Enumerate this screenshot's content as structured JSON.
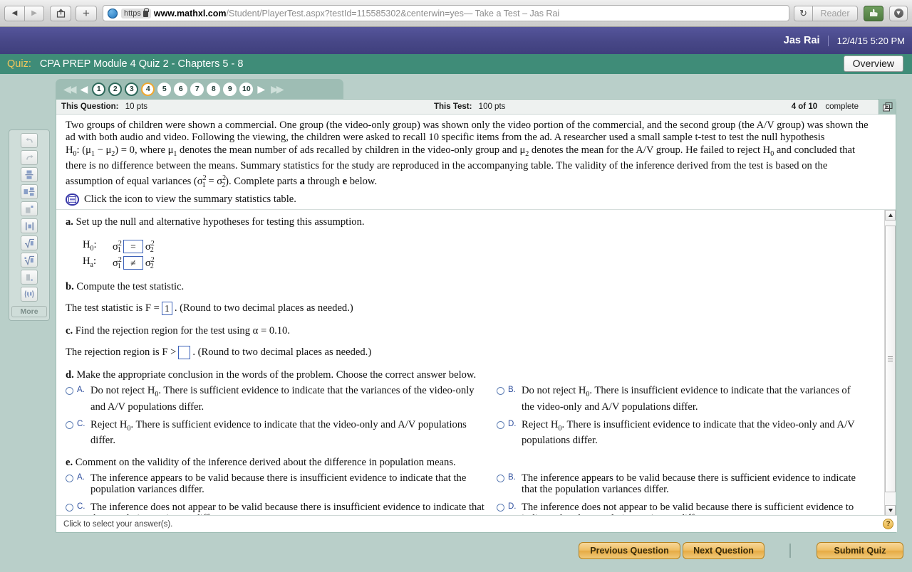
{
  "browser": {
    "back_icon": "back-arrow-icon",
    "forward_icon": "forward-arrow-icon",
    "share_icon": "share-icon",
    "new_tab_label": "+",
    "https_label": "https",
    "url_domain": "www.mathxl.com",
    "url_path": "/Student/PlayerTest.aspx?testId=115585302&centerwin=yes",
    "page_title": " — Take a Test – Jas Rai",
    "reload_icon": "reload-icon",
    "reader_label": "Reader",
    "downloads_icon": "downloads-icon"
  },
  "header": {
    "user": "Jas Rai",
    "datetime": "12/4/15 5:20 PM",
    "quiz_label": "Quiz:",
    "quiz_title": "CPA PREP Module 4 Quiz 2 - Chapters 5 - 8",
    "overview_button": "Overview"
  },
  "qnav": {
    "first_icon": "double-left-arrow-icon",
    "prev_icon": "left-arrow-icon",
    "next_icon": "right-arrow-icon",
    "last_icon": "double-right-arrow-icon",
    "bubbles": [
      {
        "n": "1",
        "state": "done"
      },
      {
        "n": "2",
        "state": "done"
      },
      {
        "n": "3",
        "state": "done"
      },
      {
        "n": "4",
        "state": "current"
      },
      {
        "n": "5",
        "state": "plain"
      },
      {
        "n": "6",
        "state": "plain"
      },
      {
        "n": "7",
        "state": "plain"
      },
      {
        "n": "8",
        "state": "plain"
      },
      {
        "n": "9",
        "state": "plain"
      },
      {
        "n": "10",
        "state": "plain"
      }
    ]
  },
  "points_bar": {
    "this_question_label": "This Question:",
    "this_question_value": "10 pts",
    "this_test_label": "This Test:",
    "this_test_value": "100 pts",
    "progress": "4 of 10",
    "status": "complete",
    "popout_icon": "pop-out-window-icon"
  },
  "palette": {
    "keys": [
      "undo-icon",
      "redo-icon",
      "fraction-icon",
      "mixed-number-icon",
      "exponent-icon",
      "absolute-value-icon",
      "square-root-icon",
      "nth-root-icon",
      "decimal-icon",
      "interval-notation-icon"
    ],
    "more_label": "More"
  },
  "stem": {
    "line1": "Two groups of children were shown a commercial. One group (the video-only group) was shown only the video portion of the commercial, and the second group (the A/V group) was shown the",
    "line2": "ad with both audio and video. Following the viewing, the children were asked to recall 10 specific items from the ad. A researcher used a small sample t-test to test the null hypothesis",
    "line3_a": "H",
    "line3_b": "0",
    "line3_c": ": (μ",
    "line3_d": "1",
    "line3_e": " − μ",
    "line3_f": "2",
    "line3_g": ") = 0, where μ",
    "line3_h": "1",
    "line3_i": " denotes the mean number of ads recalled by children in the video-only group and μ",
    "line3_j": "2",
    "line3_k": " denotes the mean for the A/V group. He failed to reject H",
    "line3_l": "0",
    "line3_m": " and concluded that",
    "line4": "there is no difference between the means. Summary statistics for the study are reproduced in the accompanying table. The validity of the inference derived from the test is based on the",
    "line5_a": "assumption of equal variances (σ",
    "line5_b": "2",
    "line5_c": "1",
    "line5_d": " = σ",
    "line5_e": "2",
    "line5_f": "2",
    "line5_g": "). Complete parts ",
    "line5_h": "a",
    "line5_i": " through ",
    "line5_j": "e",
    "line5_k": " below.",
    "icon_line": "Click the icon to view the summary statistics table.",
    "table_icon": "summary-statistics-table-icon"
  },
  "parts": {
    "a": {
      "label": "a.",
      "prompt": "Set up the null and alternative hypotheses for testing this assumption.",
      "row1": {
        "lead": "H",
        "lead_sub": "0",
        "lhs_base": "σ",
        "lhs_sup": "2",
        "lhs_sub": "1",
        "operator": "=",
        "rhs_base": "σ",
        "rhs_sup": "2",
        "rhs_sub": "2"
      },
      "row2": {
        "lead": "H",
        "lead_sub": "a",
        "lhs_base": "σ",
        "lhs_sup": "2",
        "lhs_sub": "1",
        "operator": "≠",
        "rhs_base": "σ",
        "rhs_sup": "2",
        "rhs_sub": "2"
      }
    },
    "b": {
      "label": "b.",
      "prompt": "Compute the test statistic.",
      "sentence_pre": "The test statistic is F =",
      "input_value": "1",
      "sentence_post": ". (Round to two decimal places as needed.)"
    },
    "c": {
      "label": "c.",
      "prompt_pre": "Find the rejection region for the test using α = 0.10.",
      "sentence_pre": "The rejection region is F >",
      "input_value": "",
      "sentence_post": ". (Round to two decimal places as needed.)"
    },
    "d": {
      "label": "d.",
      "prompt": "Make the appropriate conclusion in the words of the problem. Choose the correct answer below.",
      "options": [
        {
          "letter": "A.",
          "text_a": "Do not reject H",
          "sub": "0",
          "text_b": ". There is sufficient evidence to indicate that the variances of the video-only and A/V populations differ.",
          "selected": false
        },
        {
          "letter": "B.",
          "text_a": "Do not reject H",
          "sub": "0",
          "text_b": ". There is insufficient evidence to indicate that the variances of the video-only and A/V populations differ.",
          "selected": false
        },
        {
          "letter": "C.",
          "text_a": "Reject H",
          "sub": "0",
          "text_b": ". There is sufficient evidence to indicate that the video-only and A/V populations differ.",
          "selected": false
        },
        {
          "letter": "D.",
          "text_a": "Reject H",
          "sub": "0",
          "text_b": ". There is insufficient evidence to indicate that the video-only and A/V populations differ.",
          "selected": false
        }
      ]
    },
    "e": {
      "label": "e.",
      "prompt": "Comment on the validity of the inference derived about the difference in population means.",
      "options": [
        {
          "letter": "A.",
          "text_a": "The inference appears to be valid because there is insufficient evidence to indicate that the population variances differ.",
          "sub": "",
          "text_b": "",
          "selected": false
        },
        {
          "letter": "B.",
          "text_a": "The inference appears to be valid because there is sufficient evidence to indicate that the population variances differ.",
          "sub": "",
          "text_b": "",
          "selected": false
        },
        {
          "letter": "C.",
          "text_a": "The inference does not appear to be valid because there is insufficient evidence to indicate that the population variances differ.",
          "sub": "",
          "text_b": "",
          "selected": false
        },
        {
          "letter": "D.",
          "text_a": "The inference does not appear to be valid because there is sufficient evidence to indicate that the population variances differ.",
          "sub": "",
          "text_b": "",
          "selected": false
        }
      ]
    }
  },
  "hint_bar": {
    "text": "Click to select your answer(s).",
    "help_icon": "help-question-icon"
  },
  "footer": {
    "previous_button": "Previous Question",
    "next_button": "Next Question",
    "submit_button": "Submit Quiz"
  },
  "colors": {
    "app_purple": "#474787",
    "app_green": "#3f8c78",
    "page_bg": "#b9cfc9",
    "accent_gold": "#efbe63",
    "current_question": "#f0a830",
    "input_border": "#3d62b8",
    "option_letter": "#2f4f9e"
  }
}
